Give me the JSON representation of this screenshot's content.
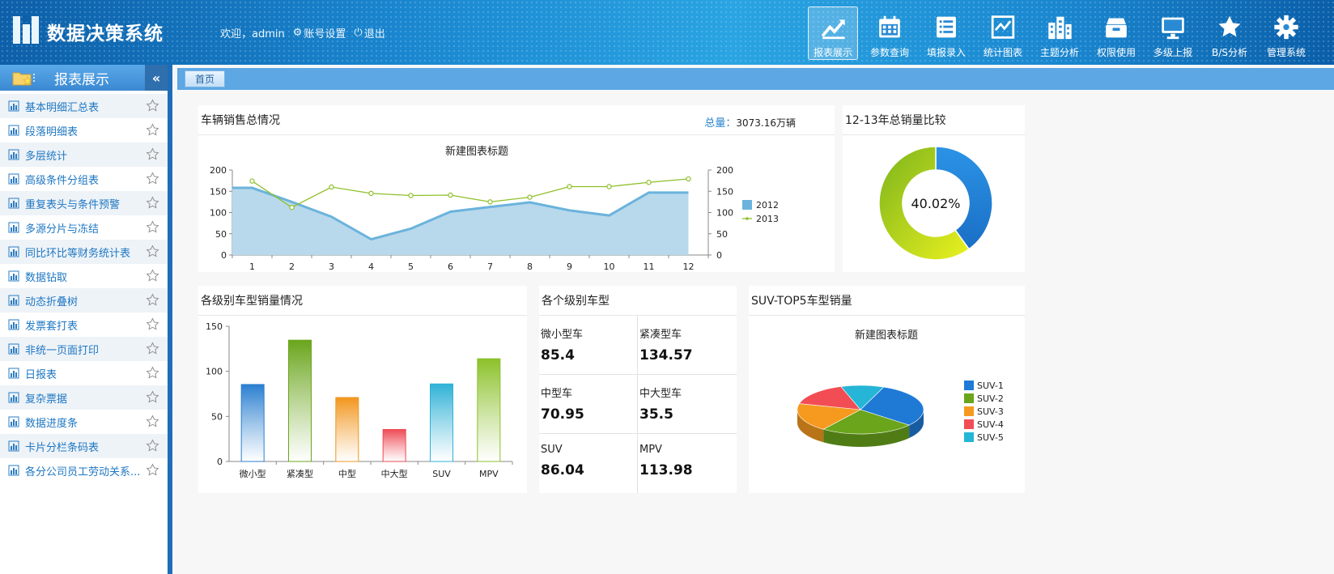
{
  "header": {
    "title": "数据决策系统",
    "welcome": "欢迎，admin",
    "account_settings": "账号设置",
    "logout": "退出",
    "nav": [
      {
        "label": "报表展示",
        "icon": "trend-chart-icon",
        "active": true
      },
      {
        "label": "参数查询",
        "icon": "calendar-icon",
        "active": false
      },
      {
        "label": "填报录入",
        "icon": "list-icon",
        "active": false
      },
      {
        "label": "统计图表",
        "icon": "line-chart-icon",
        "active": false
      },
      {
        "label": "主题分析",
        "icon": "buildings-icon",
        "active": false
      },
      {
        "label": "权限使用",
        "icon": "box-icon",
        "active": false
      },
      {
        "label": "多级上报",
        "icon": "monitor-icon",
        "active": false
      },
      {
        "label": "B/S分析",
        "icon": "star-icon",
        "active": false
      },
      {
        "label": "管理系统",
        "icon": "gear-icon",
        "active": false
      }
    ]
  },
  "sidebar": {
    "title": "报表展示",
    "collapse": "«",
    "items": [
      "基本明细汇总表",
      "段落明细表",
      "多层统计",
      "高级条件分组表",
      "重复表头与条件预警",
      "多源分片与冻结",
      "同比环比等财务统计表",
      "数据钻取",
      "动态折叠树",
      "发票套打表",
      "非统一页面打印",
      "日报表",
      "复杂票据",
      "数据进度条",
      "卡片分栏条码表",
      "各分公司员工劳动关系..."
    ]
  },
  "tabs": {
    "home": "首页"
  },
  "panels": {
    "sales": {
      "title": "车辆销售总情况",
      "total_label": "总量：",
      "total_value": "3073.16万辆"
    },
    "compare": {
      "title": "12-13年总销量比较"
    },
    "types": {
      "title": "各级别车型销量情况"
    },
    "levels": {
      "title": "各个级别车型",
      "cells": [
        {
          "label": "微小型车",
          "value": "85.4"
        },
        {
          "label": "紧凑型车",
          "value": "134.57"
        },
        {
          "label": "中型车",
          "value": "70.95"
        },
        {
          "label": "中大型车",
          "value": "35.5"
        },
        {
          "label": "SUV",
          "value": "86.04"
        },
        {
          "label": "MPV",
          "value": "113.98"
        }
      ]
    },
    "suv": {
      "title": "SUV-TOP5车型销量"
    }
  },
  "chart_data": [
    {
      "type": "line",
      "title": "新建图表标题",
      "x": [
        1,
        2,
        3,
        4,
        5,
        6,
        7,
        8,
        9,
        10,
        11,
        12
      ],
      "ylim": [
        0,
        200
      ],
      "y2lim": [
        0,
        200
      ],
      "yticks": [
        0,
        50,
        100,
        150,
        200
      ],
      "series": [
        {
          "name": "2012",
          "kind": "area",
          "color": "#6bb3dc",
          "values": [
            158,
            125,
            90,
            37,
            62,
            102,
            113,
            124,
            105,
            93,
            147,
            147
          ]
        },
        {
          "name": "2013",
          "kind": "line",
          "color": "#8fbf2a",
          "values": [
            174,
            112,
            160,
            145,
            140,
            141,
            125,
            136,
            161,
            161,
            171,
            179
          ]
        }
      ],
      "legend": "right"
    },
    {
      "type": "pie",
      "donut": true,
      "center_label": "40.02%",
      "values": [
        40.02,
        59.98
      ],
      "colors": [
        "#1c7fd8",
        "#a9d41a"
      ]
    },
    {
      "type": "bar",
      "categories": [
        "微小型",
        "紧凑型",
        "中型",
        "中大型",
        "SUV",
        "MPV"
      ],
      "values": [
        85.4,
        134.57,
        70.95,
        35.5,
        86.04,
        113.98
      ],
      "colors": [
        "#2a7fd0",
        "#6aa51c",
        "#f2961e",
        "#ee4a55",
        "#2fb1d6",
        "#8bc12a"
      ],
      "ylim": [
        0,
        150
      ],
      "yticks": [
        0,
        50,
        100,
        150
      ]
    },
    {
      "type": "pie",
      "title": "新建图表标题",
      "categories": [
        "SUV-1",
        "SUV-2",
        "SUV-3",
        "SUV-4",
        "SUV-5"
      ],
      "values": [
        30,
        24,
        19,
        16,
        11
      ],
      "colors": [
        "#1f7ad6",
        "#6aa51c",
        "#f59a1f",
        "#f24d54",
        "#25b5d6"
      ],
      "legend": "right"
    }
  ]
}
